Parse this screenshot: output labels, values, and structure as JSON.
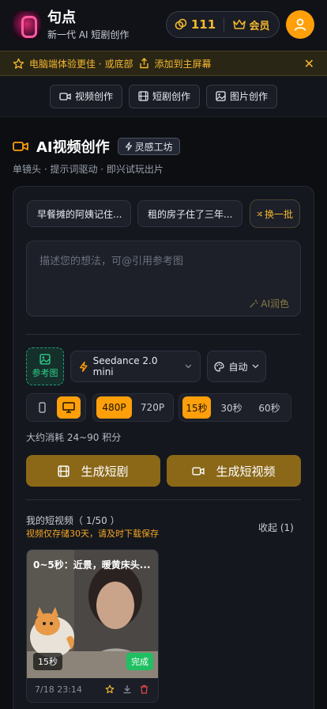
{
  "header": {
    "brand_name": "句点",
    "brand_sub": "新一代 AI 短剧创作",
    "credits": "111",
    "vip_label": "会员"
  },
  "banner": {
    "text1": "电脑端体验更佳 · 或底部",
    "text2": "添加到主屏幕",
    "close": "✕"
  },
  "tabs": [
    {
      "label": "视频创作"
    },
    {
      "label": "短剧创作"
    },
    {
      "label": "图片创作"
    }
  ],
  "section": {
    "title": "AI视频创作",
    "badge": "灵感工坊",
    "subtitle": "单镜头 · 提示词驱动 · 即兴试玩出片"
  },
  "suggestions": [
    "早餐摊的阿姨记住...",
    "租的房子住了三年..."
  ],
  "refresh_label": "换一批",
  "prompt": {
    "placeholder": "描述您的想法，可@引用参考图",
    "ai_polish": "AI润色"
  },
  "options": {
    "ref_image": "参考图",
    "model": "Seedance 2.0 mini",
    "style": "自动",
    "resolutions": [
      "480P",
      "720P"
    ],
    "durations": [
      "15秒",
      "30秒",
      "60秒"
    ],
    "selected_resolution": "480P",
    "selected_duration": "15秒"
  },
  "cost": "大约消耗 24~90 积分",
  "buttons": {
    "gen_drama": "生成短剧",
    "gen_video": "生成短视频"
  },
  "my_videos": {
    "title": "我的短视频（ 1/50 ）",
    "warning": "视频仅存储30天，请及时下载保存",
    "fav": "收起 (1)",
    "items": [
      {
        "caption": "0~5秒：近景，暖黄床头...",
        "duration": "15秒",
        "status": "完成",
        "date": "7/18 23:14"
      }
    ]
  },
  "colors": {
    "accent": "#ff9f0a",
    "gold": "#f5b82e",
    "success": "#1fbf62"
  }
}
